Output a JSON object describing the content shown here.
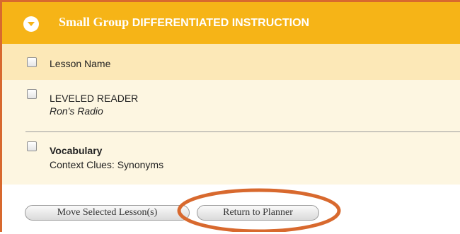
{
  "header": {
    "title_part1": "Small Group ",
    "title_part2": "DIFFERENTIATED INSTRUCTION",
    "toggle_icon": "chevron-down-icon"
  },
  "lessons": {
    "column_header": "Lesson Name",
    "items": [
      {
        "title": "LEVELED READER",
        "subtitle": "Ron's Radio"
      },
      {
        "title": "Vocabulary",
        "subtitle": "Context Clues: Synonyms"
      }
    ]
  },
  "actions": {
    "move_label": "Move Selected Lesson(s)",
    "return_label": "Return to Planner"
  },
  "colors": {
    "header_bg": "#f6b417",
    "highlight_row_bg": "#fce8b7",
    "panel_bg": "#fdf6e1",
    "annotation_circle": "#d8692e"
  }
}
